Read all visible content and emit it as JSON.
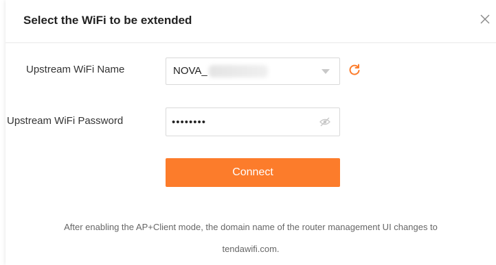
{
  "dialog": {
    "title": "Select the WiFi to be extended",
    "close_icon": "close-icon"
  },
  "form": {
    "ssid_label": "Upstream WiFi Name",
    "ssid_value": "NOVA_",
    "ssid_dropdown_icon": "chevron-down-icon",
    "refresh_icon": "refresh-icon",
    "password_label": "Upstream WiFi Password",
    "password_value": "••••••••",
    "password_toggle_icon": "eye-hidden-icon",
    "connect_label": "Connect"
  },
  "note": {
    "line1": "After enabling the AP+Client mode, the domain name of the router management UI changes to",
    "line2": "tendawifi.com."
  },
  "colors": {
    "accent": "#fc7c2b",
    "text": "#333333",
    "muted": "#666666",
    "border": "#d9d9d9"
  }
}
